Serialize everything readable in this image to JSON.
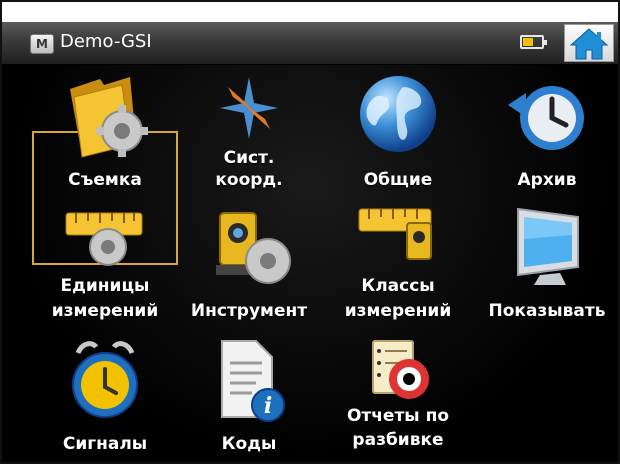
{
  "titlebar": {
    "app_badge": "M",
    "title": "Demo-GSI",
    "battery_level": 0.55,
    "icons": [
      "battery-icon",
      "home-icon"
    ]
  },
  "tiles": [
    {
      "label": "Съемка",
      "icon": "survey-folder-icon",
      "selected": true
    },
    {
      "label_lines": [
        "Сист.",
        "коорд."
      ],
      "icon": "compass-icon"
    },
    {
      "label": "Общие",
      "icon": "globe-icon"
    },
    {
      "label": "Архив",
      "icon": "archive-clock-icon"
    },
    {
      "label_lines": [
        "Единицы",
        "измерений"
      ],
      "icon": "ruler-gear-icon"
    },
    {
      "label": "Инструмент",
      "icon": "instrument-gear-icon"
    },
    {
      "label_lines": [
        "Классы",
        "измерений"
      ],
      "icon": "ruler-instrument-icon"
    },
    {
      "label": "Показывать",
      "icon": "monitor-icon"
    },
    {
      "label": "Сигналы",
      "icon": "alarm-clock-icon"
    },
    {
      "label": "Коды",
      "icon": "document-info-icon"
    },
    {
      "label_lines": [
        "Отчеты по",
        "разбивке"
      ],
      "icon": "report-lifebuoy-icon"
    }
  ]
}
